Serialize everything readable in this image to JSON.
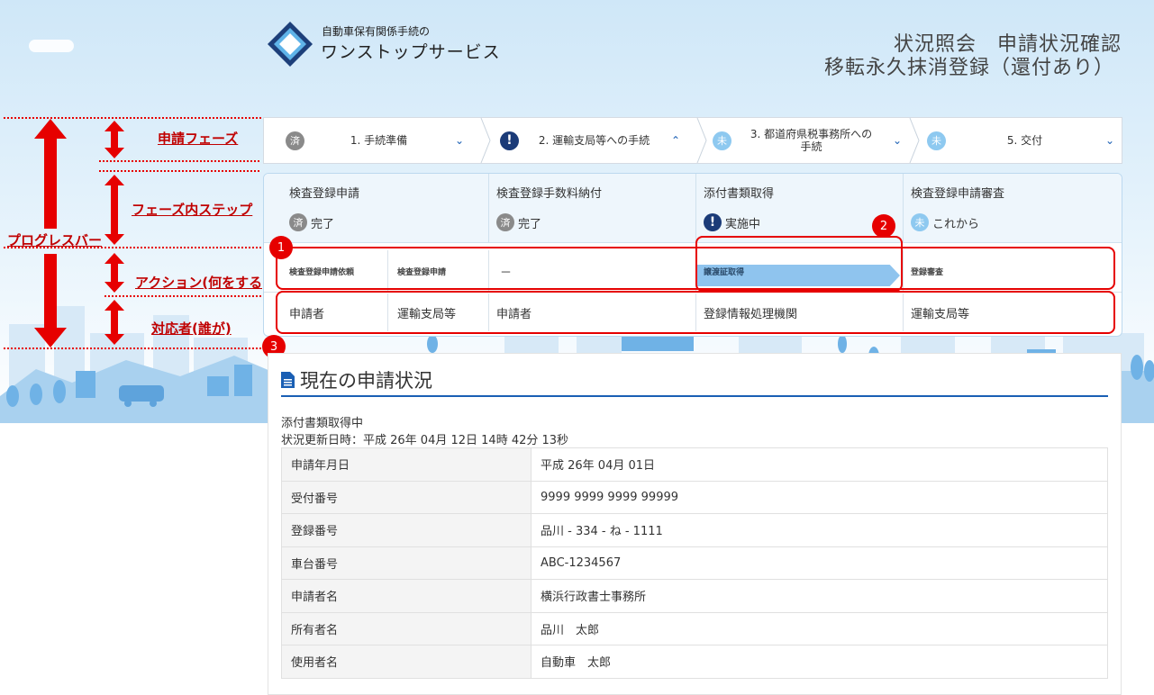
{
  "header": {
    "logo_sub": "自動車保有関係手続の",
    "logo_main": "ワンストップサービス",
    "title_line1": "状況照会　申請状況確認",
    "title_line2": "移転永久抹消登録（還付あり）"
  },
  "annotations": {
    "progress_bar": "プログレスバー",
    "phase": "申請フェーズ",
    "phase_step": "フェーズ内ステップ",
    "action": "アクション(何をする)",
    "actor": "対応者(誰が)"
  },
  "phases": [
    {
      "badge": "済",
      "label": "1. 手続準備",
      "chevron": "chevron-down",
      "state": "done"
    },
    {
      "badge": "!",
      "label": "2. 運輸支局等への手続",
      "chevron": "chevron-up",
      "state": "current"
    },
    {
      "badge": "未",
      "label_line1": "3. 都道府県税事務所への",
      "label_line2": "手続",
      "chevron": "chevron-down",
      "state": "future"
    },
    {
      "badge": "未",
      "label": "5. 交付",
      "chevron": "chevron-down",
      "state": "future"
    }
  ],
  "steps": [
    {
      "name": "検査登録申請",
      "badge": "済",
      "status": "完了"
    },
    {
      "name": "検査登録手数料納付",
      "badge": "済",
      "status": "完了"
    },
    {
      "name": "添付書類取得",
      "badge": "!",
      "status": "実施中"
    },
    {
      "name": "検査登録申請審査",
      "badge": "未",
      "status": "これから"
    }
  ],
  "actions": [
    "検査登録申請依頼",
    "検査登録申請",
    "－",
    "譲渡証取得",
    "登録審査"
  ],
  "actors": [
    "申請者",
    "運輸支局等",
    "申請者",
    "登録情報処理機関",
    "運輸支局等"
  ],
  "markers": [
    "1",
    "2",
    "3"
  ],
  "status": {
    "title": "現在の申請状況",
    "current": "添付書類取得中",
    "updated": "状況更新日時：平成 26年 04月 12日 14時 42分 13秒",
    "rows": [
      {
        "label": "申請年月日",
        "value": "平成 26年 04月 01日"
      },
      {
        "label": "受付番号",
        "value": "9999 9999 9999 99999"
      },
      {
        "label": "登録番号",
        "value": "品川 - 334 - ね - 1111"
      },
      {
        "label": "車台番号",
        "value": "ABC-1234567"
      },
      {
        "label": "申請者名",
        "value": "横浜行政書士事務所"
      },
      {
        "label": "所有者名",
        "value": "品川　太郎"
      },
      {
        "label": "使用者名",
        "value": "自動車　太郎"
      }
    ]
  },
  "colors": {
    "accent": "#1a5fb4",
    "annotation_red": "#e60000",
    "done_badge": "#8a8a8a",
    "current_badge": "#1b3b78",
    "future_badge": "#8ec9f0",
    "arrow_fill": "#8fc4ee"
  }
}
